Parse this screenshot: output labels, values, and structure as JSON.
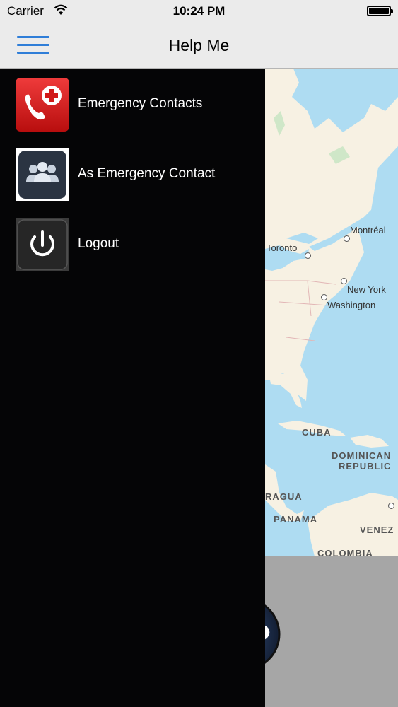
{
  "status_bar": {
    "carrier": "Carrier",
    "time": "10:24 PM"
  },
  "nav": {
    "title": "Help Me"
  },
  "menu": {
    "items": [
      {
        "label": "Emergency Contacts",
        "icon": "phone-plus-icon"
      },
      {
        "label": "As Emergency Contact",
        "icon": "group-icon"
      },
      {
        "label": "Logout",
        "icon": "power-icon"
      }
    ]
  },
  "map": {
    "labels": {
      "montreal": "Montréal",
      "toronto": "Toronto",
      "new_york": "New York",
      "washington": "Washington",
      "cuba": "CUBA",
      "dominican_1": "DOMINICAN",
      "dominican_2": "REPUBLIC",
      "nicaragua": "RAGUA",
      "panama": "PANAMA",
      "venezuela": "VENEZ",
      "colombia": "COLOMBIA"
    }
  },
  "colors": {
    "accent": "#2f7ed8",
    "drawer": "#050506",
    "water": "#aedcf2",
    "land": "#f7f1e3"
  }
}
